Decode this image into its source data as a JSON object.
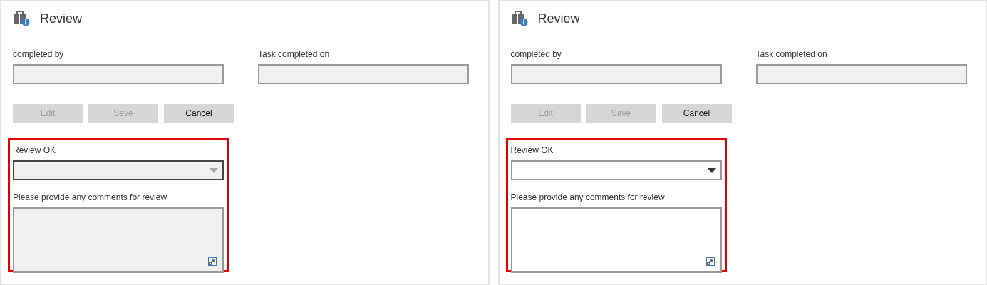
{
  "panels": [
    {
      "title": "Review",
      "fields": [
        {
          "label": "completed by"
        },
        {
          "label": "Task completed on"
        }
      ],
      "buttons": [
        {
          "label": "Edit",
          "disabled": true
        },
        {
          "label": "Save",
          "disabled": true
        },
        {
          "label": "Cancel",
          "disabled": false
        }
      ],
      "highlighted": true,
      "review_ok": {
        "label": "Review OK",
        "disabled": true
      },
      "comments": {
        "label": "Please provide any comments for review",
        "disabled": true
      }
    },
    {
      "title": "Review",
      "fields": [
        {
          "label": "completed by"
        },
        {
          "label": "Task completed on"
        }
      ],
      "buttons": [
        {
          "label": "Edit",
          "disabled": true
        },
        {
          "label": "Save",
          "disabled": true
        },
        {
          "label": "Cancel",
          "disabled": false
        }
      ],
      "highlighted": true,
      "review_ok": {
        "label": "Review OK",
        "disabled": false
      },
      "comments": {
        "label": "Please provide any comments for review",
        "disabled": false
      }
    }
  ]
}
